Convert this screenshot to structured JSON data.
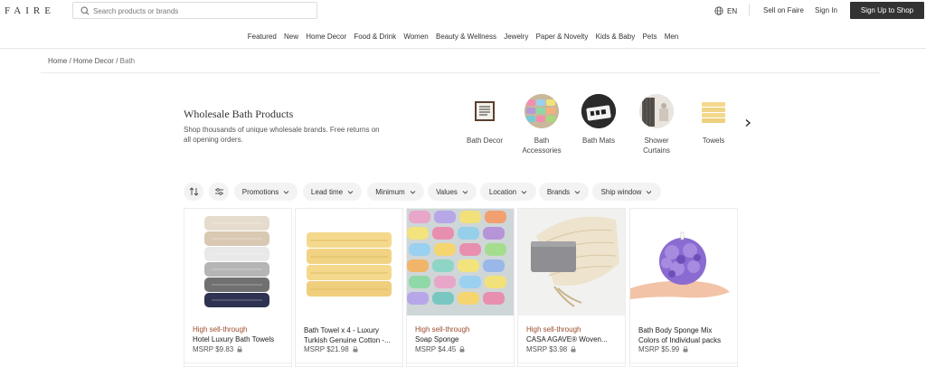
{
  "header": {
    "logo": "FAIRE",
    "search_placeholder": "Search products or brands",
    "language": "EN",
    "sell_link": "Sell on Faire",
    "signin_link": "Sign In",
    "signup_button": "Sign Up to Shop"
  },
  "nav": {
    "items": [
      "Featured",
      "New",
      "Home Decor",
      "Food & Drink",
      "Women",
      "Beauty & Wellness",
      "Jewelry",
      "Paper & Novelty",
      "Kids & Baby",
      "Pets",
      "Men"
    ]
  },
  "breadcrumb": {
    "home": "Home",
    "parent": "Home Decor",
    "current": "Bath",
    "separator": "/"
  },
  "category": {
    "title": "Wholesale Bath Products",
    "description": "Shop thousands of unique wholesale brands. Free returns on all opening orders.",
    "subcategories": [
      {
        "label_line1": "Bath Decor",
        "label_line2": ""
      },
      {
        "label_line1": "Bath",
        "label_line2": "Accessories"
      },
      {
        "label_line1": "Bath Mats",
        "label_line2": ""
      },
      {
        "label_line1": "Shower",
        "label_line2": "Curtains"
      },
      {
        "label_line1": "Towels",
        "label_line2": ""
      }
    ]
  },
  "filters": {
    "pills": [
      "Promotions",
      "Lead time",
      "Minimum",
      "Values",
      "Location",
      "Brands",
      "Ship window"
    ]
  },
  "products": [
    {
      "tag": "High sell-through",
      "name": "Hotel Luxury Bath Towels",
      "price": "MSRP $9.83"
    },
    {
      "tag": "",
      "name": "Bath Towel x 4 - Luxury Turkish Genuine Cotton -...",
      "price": "MSRP $21.98"
    },
    {
      "tag": "High sell-through",
      "name": "Soap Sponge",
      "price": "MSRP $4.45"
    },
    {
      "tag": "High sell-through",
      "name": "CASA AGAVE® Woven...",
      "price": "MSRP $3.98"
    },
    {
      "tag": "",
      "name": "Bath Body Sponge Mix Colors of Individual packs",
      "price": "MSRP $5.99"
    }
  ],
  "colors": {
    "accent_dark": "#333333",
    "tag_color": "#9b4a2c",
    "pill_bg": "#f3f3f3"
  }
}
